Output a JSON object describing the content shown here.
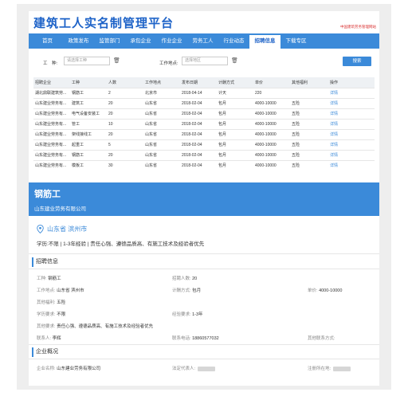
{
  "header": {
    "title": "建筑工人实名制管理平台",
    "subtitle": "中国建筑劳务管理网站"
  },
  "nav": {
    "items": [
      "首页",
      "政策发布",
      "监管部门",
      "承包企业",
      "作业企业",
      "劳务工人",
      "行业动态",
      "招聘信息",
      "下载专区"
    ],
    "active": "招聘信息"
  },
  "filters": {
    "job_label": "工　种:",
    "job_placeholder": "请选择工种",
    "location_label": "工作地点:",
    "location_placeholder": "选择地区",
    "search_label": "搜索"
  },
  "table": {
    "columns": [
      "招聘企业",
      "工种",
      "人数",
      "工作地点",
      "发布日期",
      "计酬方式",
      "单价",
      "其他福利",
      "操作"
    ],
    "rows": [
      [
        "湖北鼎联建筑劳...",
        "钢筋工",
        "2",
        "北京市",
        "2018-04-14",
        "计天",
        "220",
        "",
        "详情"
      ],
      [
        "山东建业劳务有...",
        "建筑工",
        "20",
        "山东省",
        "2018-02-04",
        "包月",
        "4000-10000",
        "五险",
        "详情"
      ],
      [
        "山东建业劳务有...",
        "电气设备安装工",
        "20",
        "山东省",
        "2018-02-04",
        "包月",
        "4000-10000",
        "五险",
        "详情"
      ],
      [
        "山东建业劳务有...",
        "管工",
        "10",
        "山东省",
        "2018-02-04",
        "包月",
        "4000-10000",
        "五险",
        "详情"
      ],
      [
        "山东建业劳务有...",
        "架线接线工",
        "20",
        "山东省",
        "2018-02-04",
        "包月",
        "4000-10000",
        "五险",
        "详情"
      ],
      [
        "山东建业劳务有...",
        "起重工",
        "5",
        "山东省",
        "2018-02-04",
        "包月",
        "4000-10000",
        "五险",
        "详情"
      ],
      [
        "山东建业劳务有...",
        "钢筋工",
        "20",
        "山东省",
        "2018-02-04",
        "包月",
        "4000-10000",
        "五险",
        "详情"
      ],
      [
        "山东建业劳务有...",
        "模板工",
        "30",
        "山东省",
        "2018-02-04",
        "包月",
        "4000-10000",
        "五险",
        "详情"
      ]
    ]
  },
  "detail": {
    "job_title": "钢筋工",
    "company": "山东建业劳务有限公司",
    "location": "山东省 滨州市",
    "requirements": "学历:不限 | 1-3年经验 | 责任心强、遵德品质高、有施工技术及经验者优先",
    "section_recruit": "招聘信息",
    "fields": {
      "job_k": "工种:",
      "job_v": "钢筋工",
      "count_k": "招聘人数:",
      "count_v": "20",
      "place_k": "工作地点:",
      "place_v": "山东省 滨州市",
      "pay_k": "计酬方式:",
      "pay_v": "包月",
      "price_k": "单价:",
      "price_v": "4000-10000",
      "welfare_k": "其他福利:",
      "welfare_v": "五险",
      "edu_k": "学历要求:",
      "edu_v": "不限",
      "exp_k": "经验要求:",
      "exp_v": "1-3年",
      "other_k": "其他要求:",
      "other_v": "责任心强、遵德品质高、有施工技术及经验者优先",
      "contact_k": "联系人:",
      "contact_v": "李辉",
      "phone_k": "联系电话:",
      "phone_v": "18860577032",
      "otherc_k": "其他联系方式:",
      "otherc_v": ""
    },
    "section_company": "企业概况",
    "company_fields": {
      "name_k": "企业名称:",
      "name_v": "山东建业劳务有限公司",
      "legal_k": "法定代表人:",
      "reg_k": "注册所在地:"
    }
  },
  "colors": {
    "brand": "#1e63c8",
    "nav": "#3b8ad9",
    "accent_red": "#d93030"
  }
}
